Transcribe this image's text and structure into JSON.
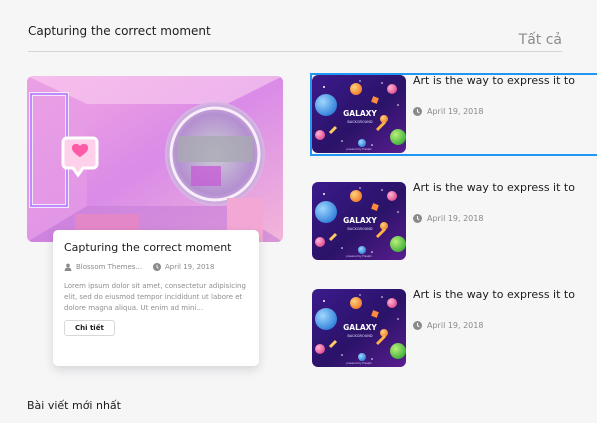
{
  "section": {
    "title": "Capturing the correct moment",
    "see_all_label": "Tất cả"
  },
  "featured": {
    "title": "Capturing the correct moment",
    "author": "Blossom Themes...",
    "date": "April 19, 2018",
    "excerpt": "Lorem ipsum dolor sit amet, consectetur adipisicing elit, sed do eiusmod tempor incididunt ut labore et dolore magna aliqua. Ut enim ad mini...",
    "button_label": "Chi tiết",
    "image_icon": "neon-heart-room-image"
  },
  "posts": [
    {
      "title": "Art is the way to express it to",
      "date": "April 19, 2018",
      "thumb": {
        "heading": "GALAXY",
        "subheading": "BACKGROUND",
        "footer": "powered by Freepik"
      }
    },
    {
      "title": "Art is the way to express it to",
      "date": "April 19, 2018",
      "thumb": {
        "heading": "GALAXY",
        "subheading": "BACKGROUND",
        "footer": "powered by Freepik"
      }
    },
    {
      "title": "Art is the way to express it to",
      "date": "April 19, 2018",
      "thumb": {
        "heading": "GALAXY",
        "subheading": "BACKGROUND",
        "footer": "powered by Freepik"
      }
    }
  ],
  "latest": {
    "title": "Bài viết mới nhất"
  },
  "colors": {
    "accent_selection": "#2196f3",
    "background": "#f6f6f7",
    "muted_text": "#8a8a8a"
  }
}
